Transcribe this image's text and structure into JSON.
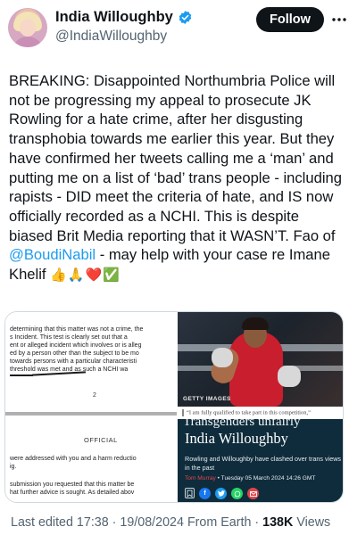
{
  "author": {
    "display_name": "India Willoughby",
    "handle": "@IndiaWilloughby",
    "verified": true
  },
  "actions": {
    "follow_label": "Follow",
    "more_icon": "more-horizontal-icon"
  },
  "tweet": {
    "text_part1": "BREAKING: Disappointed Northumbria Police will not be progressing my appeal to prosecute JK Rowling for a hate crime, after her disgusting transphobia towards me earlier this year. But they have confirmed her tweets calling me a ‘man’ and putting me on a list of ‘bad’ trans people - including rapists - DID meet the criteria of hate, and IS now officially recorded as a NCHI. This is despite biased Brit Media reporting that it WASN’T. Fao of ",
    "mention": "@BoudiNabil",
    "text_part2": " - may help with your case re Imane Khelif ",
    "emojis": "👍🙏❤️✅"
  },
  "media": {
    "document": {
      "line1": "determining that this matter was not a crime, the",
      "line2": "s Incident. This test is clearly set out that a",
      "line3": "ent or alleged incident which involves or is alleg",
      "line4": "ed by a person other than the subject to be mo",
      "line5": "towards persons with a particular characteristi",
      "line6": "threshold was met and as such a NCHI wa",
      "page_number": "2",
      "official_label": "OFFICIAL",
      "line7": "were addressed with you and a harm reductio",
      "line8": "ig.",
      "line9": "submission you requested that this matter be",
      "line10": "hat further advice is sought. As detailed abov"
    },
    "photo": {
      "credit": "GETTY IMAGES"
    },
    "caption": "“I am fully qualified to take part in this competition,”",
    "article": {
      "cut_headline": "Transgenders unfairly",
      "author_name": "India Willoughby",
      "standfirst": "Rowling and Willoughby have clashed over trans views in the past",
      "byline_author": "Tom Murray",
      "byline_date": " • Tuesday 05 March 2024 14:26 GMT",
      "share_icons": [
        "bookmark-icon",
        "facebook-icon",
        "twitter-icon",
        "whatsapp-icon",
        "email-icon"
      ]
    }
  },
  "meta": {
    "last_edited": "Last edited 17:38 · 19/08/2024",
    "source": " From Earth · ",
    "views_count": "138K",
    "views_label": " Views"
  },
  "colors": {
    "accent": "#1d9bf0",
    "text_primary": "#0f1419",
    "text_secondary": "#536471",
    "verified": "#1d9bf0",
    "article_bg": "#0f2c3c"
  }
}
